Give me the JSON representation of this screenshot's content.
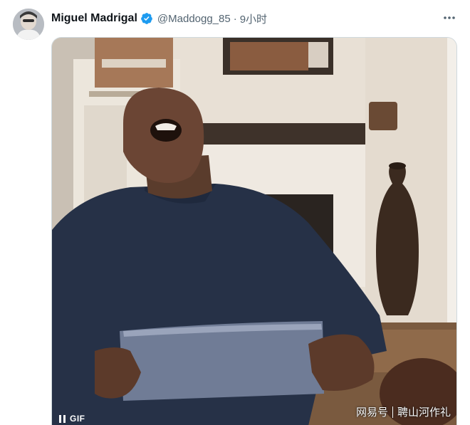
{
  "tweet": {
    "display_name": "Miguel Madrigal",
    "verified": true,
    "handle": "@Maddogg_85",
    "separator": "·",
    "time": "9小时",
    "more_icon": "more-horizontal-icon",
    "avatar_icon": "user-avatar"
  },
  "media": {
    "type": "gif",
    "badge_label": "GIF",
    "pause_icon": "pause-icon"
  },
  "watermark": {
    "platform": "网易号",
    "account": "聘山河作礼"
  },
  "colors": {
    "verified_blue": "#1d9bf0",
    "secondary_text": "#536471",
    "border": "#cfd9de"
  }
}
